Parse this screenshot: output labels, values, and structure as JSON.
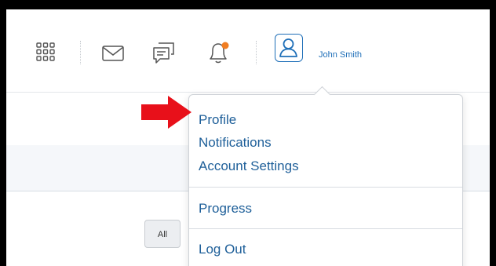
{
  "navbar": {
    "icons": [
      "apps-grid-icon",
      "mail-icon",
      "chat-icon",
      "bell-icon"
    ],
    "notification_color": "#f07d22"
  },
  "user": {
    "name": "John Smith"
  },
  "filter": {
    "all_label": "All"
  },
  "menu": {
    "items": [
      {
        "label": "Profile"
      },
      {
        "label": "Notifications"
      },
      {
        "label": "Account Settings"
      },
      {
        "label": "Progress"
      },
      {
        "label": "Log Out"
      }
    ]
  },
  "colors": {
    "link": "#1e5f99",
    "accent": "#1f5f9e",
    "arrow": "#e8101a"
  }
}
